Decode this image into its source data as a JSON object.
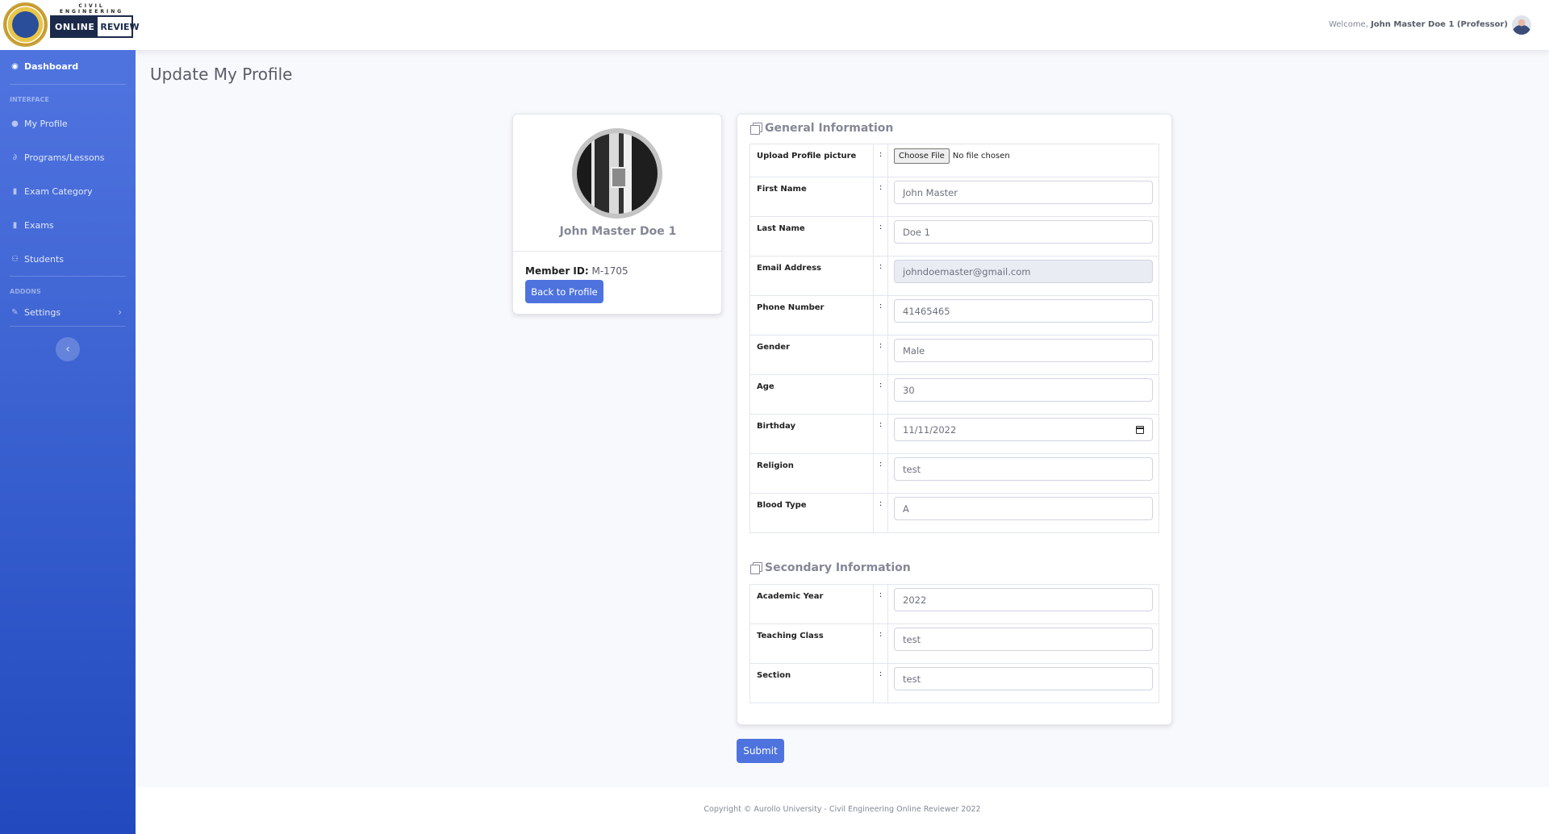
{
  "brand": {
    "sub": "CIVIL ENGINEERING",
    "online": "ONLINE",
    "review": "REVIEW"
  },
  "topbar": {
    "welcome_prefix": "Welcome,",
    "user": "John Master Doe 1 (Professor)"
  },
  "sidebar": {
    "dashboard": "Dashboard",
    "heading_interface": "INTERFACE",
    "items": [
      {
        "label": "My Profile",
        "icon": "user-icon"
      },
      {
        "label": "Programs/Lessons",
        "icon": "paperclip-icon"
      },
      {
        "label": "Exam Category",
        "icon": "file-icon"
      },
      {
        "label": "Exams",
        "icon": "file-icon"
      },
      {
        "label": "Students",
        "icon": "users-icon"
      }
    ],
    "heading_addons": "ADDONS",
    "settings": "Settings"
  },
  "page": {
    "title": "Update My Profile"
  },
  "profile": {
    "name": "John Master Doe 1",
    "member_label": "Member ID:",
    "member_id": "M-1705",
    "back_button": "Back to Profile"
  },
  "general": {
    "title": "General Information",
    "upload_label": "Upload Profile picture",
    "choose_file": "Choose File",
    "no_file": "No file chosen",
    "fields": [
      {
        "label": "First Name",
        "value": "John Master"
      },
      {
        "label": "Last Name",
        "value": "Doe 1"
      },
      {
        "label": "Email Address",
        "value": "johndoemaster@gmail.com"
      },
      {
        "label": "Phone Number",
        "value": "41465465"
      },
      {
        "label": "Gender",
        "value": "Male"
      },
      {
        "label": "Age",
        "value": "30"
      },
      {
        "label": "Birthday",
        "value": "11/11/2022"
      },
      {
        "label": "Religion",
        "value": "test"
      },
      {
        "label": "Blood Type",
        "value": "A"
      }
    ]
  },
  "secondary": {
    "title": "Secondary Information",
    "fields": [
      {
        "label": "Academic Year",
        "value": "2022"
      },
      {
        "label": "Teaching Class",
        "value": "test"
      },
      {
        "label": "Section",
        "value": "test"
      }
    ]
  },
  "colon": ":",
  "submit": "Submit",
  "footer": {
    "copyright": "Copyright © Aurollo University - Civil Engineering Online Reviewer 2022"
  },
  "colors": {
    "primary": "#4e73df",
    "sidebar_end": "#224abe"
  }
}
